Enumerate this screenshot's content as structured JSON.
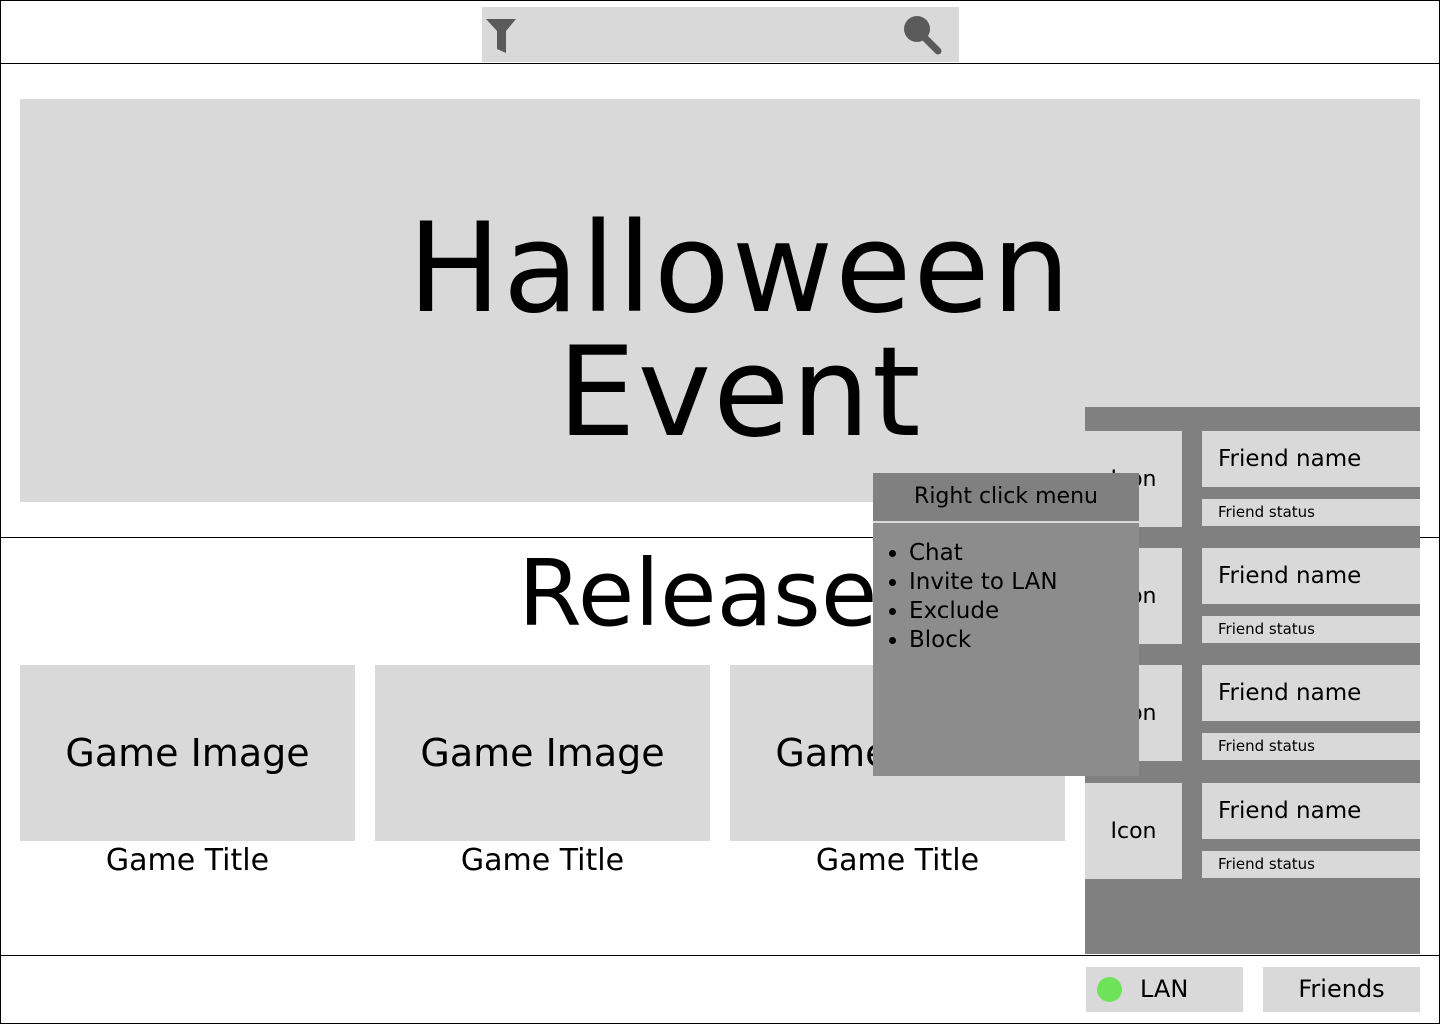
{
  "header": {
    "filter_icon": "filter-icon",
    "search_icon": "search-icon"
  },
  "banner": {
    "title": "Halloween Event"
  },
  "releases": {
    "title": "Releases",
    "games": [
      {
        "image_label": "Game Image",
        "title": "Game Title"
      },
      {
        "image_label": "Game Image",
        "title": "Game Title"
      },
      {
        "image_label": "Game Image",
        "title": "Game Title"
      }
    ]
  },
  "friends_panel": {
    "friends": [
      {
        "icon": "Icon",
        "name": "Friend name",
        "status": "Friend status"
      },
      {
        "icon": "Icon",
        "name": "Friend name",
        "status": "Friend status"
      },
      {
        "icon": "Icon",
        "name": "Friend name",
        "status": "Friend status"
      },
      {
        "icon": "Icon",
        "name": "Friend name",
        "status": "Friend status"
      }
    ]
  },
  "context_menu": {
    "title": "Right click menu",
    "items": [
      "Chat",
      "Invite to LAN",
      "Exclude",
      "Block"
    ]
  },
  "bottom_bar": {
    "lan_label": "LAN",
    "lan_status_color": "#6ee35a",
    "friends_label": "Friends"
  }
}
